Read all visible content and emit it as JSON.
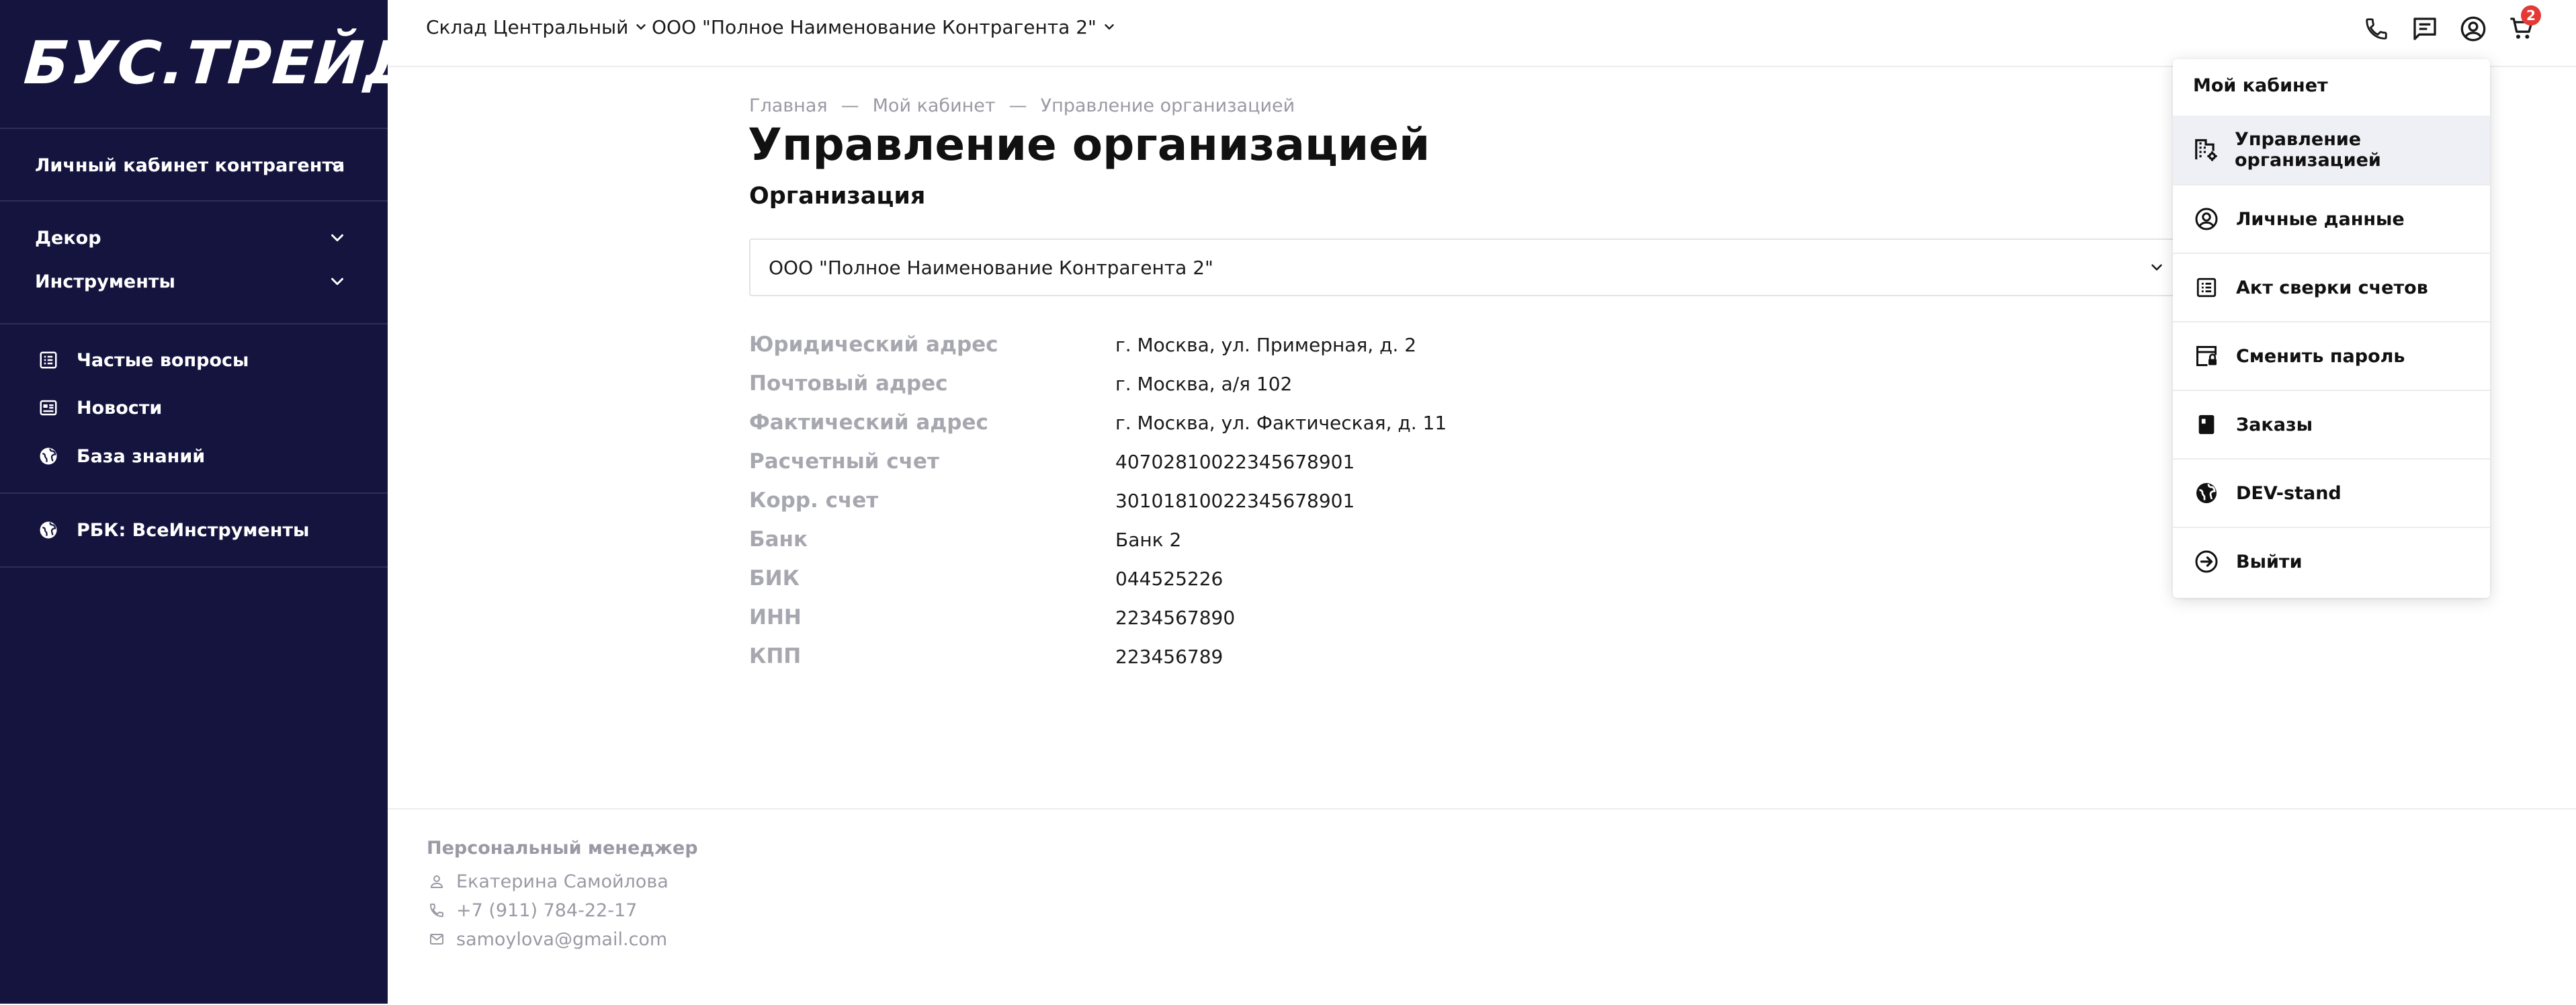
{
  "brand": {
    "logo_text": "БУС.ТРЕЙД"
  },
  "sidebar": {
    "cabinet_label": "Личный кабинет контрагента",
    "categories": [
      {
        "label": "Декор"
      },
      {
        "label": "Инструменты"
      }
    ],
    "links": [
      {
        "label": "Частые вопросы",
        "icon": "list-icon"
      },
      {
        "label": "Новости",
        "icon": "news-icon"
      },
      {
        "label": "База знаний",
        "icon": "globe-icon"
      }
    ],
    "external": {
      "label": "РБК: ВсеИнструменты",
      "icon": "globe-icon"
    }
  },
  "topbar": {
    "warehouse": "Склад Центральный",
    "counterparty": "ООО \"Полное Наименование Контрагента 2\"",
    "cart_count": "2",
    "icons": [
      "phone-icon",
      "chat-icon",
      "account-icon",
      "cart-icon"
    ]
  },
  "breadcrumb": {
    "items": [
      "Главная",
      "Мой кабинет",
      "Управление организацией"
    ],
    "separator": "—"
  },
  "page": {
    "title": "Управление организацией",
    "section_title": "Организация",
    "org_select_value": "ООО \"Полное Наименование Контрагента 2\""
  },
  "details": [
    {
      "label": "Юридический адрес",
      "value": "г. Москва, ул. Примерная, д. 2"
    },
    {
      "label": "Почтовый адрес",
      "value": "г. Москва, а/я 102"
    },
    {
      "label": "Фактический адрес",
      "value": "г. Москва, ул. Фактическая, д. 11"
    },
    {
      "label": "Расчетный счет",
      "value": "40702810022345678901"
    },
    {
      "label": "Корр. счет",
      "value": "30101810022345678901"
    },
    {
      "label": "Банк",
      "value": "Банк 2"
    },
    {
      "label": "БИК",
      "value": "044525226"
    },
    {
      "label": "ИНН",
      "value": "2234567890"
    },
    {
      "label": "КПП",
      "value": "223456789"
    }
  ],
  "manager": {
    "title": "Персональный менеджер",
    "name": "Екатерина Самойлова",
    "phone": "+7 (911) 784-22-17",
    "email": "samoylova@gmail.com"
  },
  "account_menu": {
    "header": "Мой кабинет",
    "items": [
      {
        "label": "Управление организацией",
        "icon": "building-settings-icon",
        "active": true
      },
      {
        "label": "Личные данные",
        "icon": "user-circle-icon"
      },
      {
        "label": "Акт сверки счетов",
        "icon": "list-icon"
      },
      {
        "label": "Сменить пароль",
        "icon": "lock-window-icon"
      },
      {
        "label": "Заказы",
        "icon": "orders-icon"
      },
      {
        "label": "DEV-stand",
        "icon": "globe-icon"
      },
      {
        "label": "Выйти",
        "icon": "logout-icon"
      }
    ]
  },
  "colors": {
    "sidebar_bg": "#14143f",
    "accent_badge": "#e53935",
    "menu_active_bg": "#efeff6",
    "muted_text": "#9a9aa5"
  }
}
